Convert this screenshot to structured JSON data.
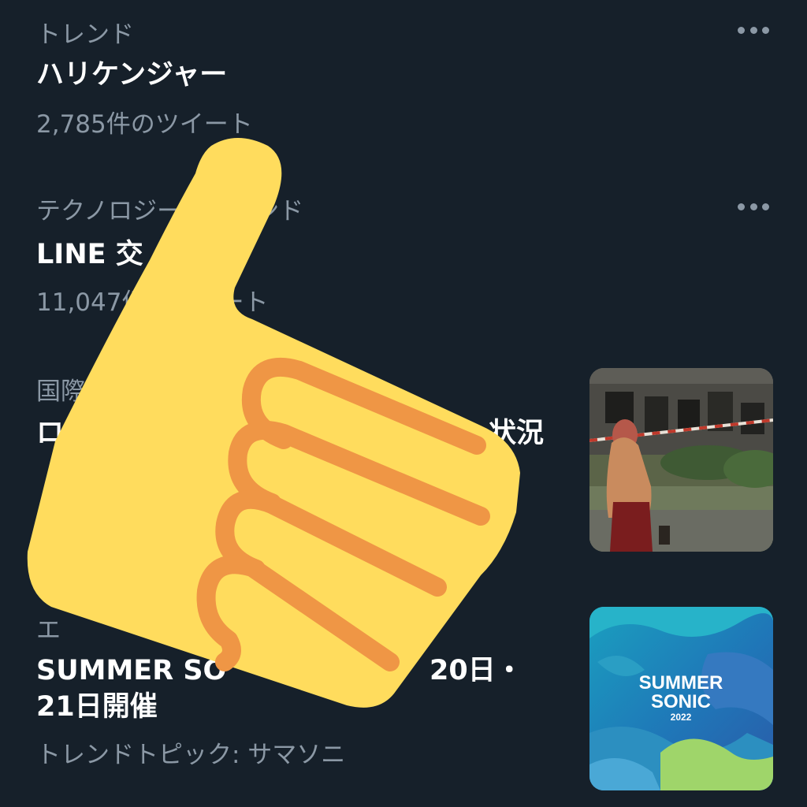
{
  "trends": [
    {
      "context": "トレンド",
      "title": "ハリケンジャー",
      "meta": "2,785件のツイート"
    },
    {
      "context": "テクノロジー・トレンド",
      "title": "LINE 交",
      "meta": "11,047件のツイート"
    },
    {
      "context": "国際",
      "title": "ロ",
      "title_tail": "状況",
      "thumbnail": "news-photo-woman-walking-past-damaged-building"
    },
    {
      "context": "エ",
      "title_line1": "SUMMER SO",
      "title_line1_tail": "20日・",
      "title_line2": "21日開催",
      "meta": "トレンドトピック: サマソニ",
      "thumbnail_text": [
        "SUMMER",
        "SONIC",
        "2022"
      ]
    }
  ],
  "overlay": {
    "icon": "thumbs-up-icon",
    "colors": {
      "skin": "#ffdc5d",
      "outline": "#ef9645"
    }
  },
  "theme": {
    "background": "#16202a",
    "primary_text": "#ffffff",
    "secondary_text": "#8b98a5"
  }
}
